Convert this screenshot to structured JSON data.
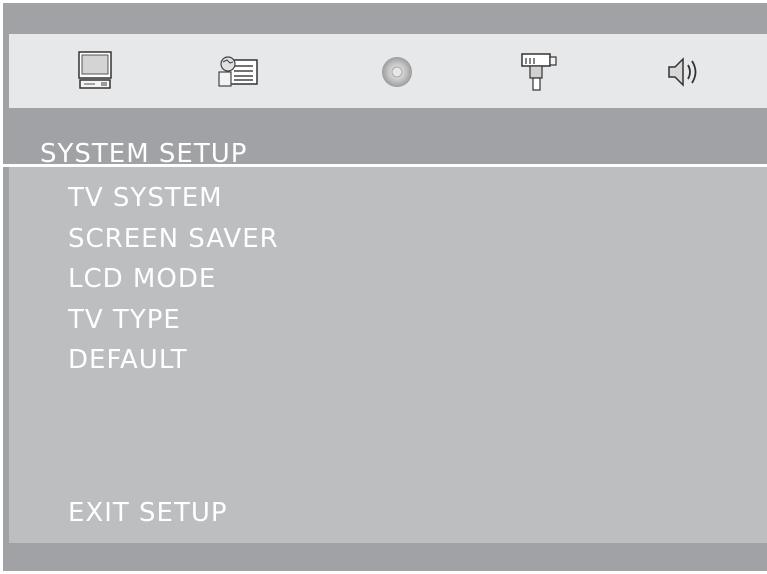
{
  "tabs": [
    {
      "icon": "monitor-icon"
    },
    {
      "icon": "document-icon"
    },
    {
      "icon": "disc-icon"
    },
    {
      "icon": "joystick-icon"
    },
    {
      "icon": "speaker-icon"
    }
  ],
  "header": {
    "title": "SYSTEM SETUP"
  },
  "menu": {
    "items": [
      "TV SYSTEM",
      "SCREEN SAVER",
      "LCD MODE",
      "TV TYPE",
      "DEFAULT"
    ],
    "exit": "EXIT SETUP"
  }
}
